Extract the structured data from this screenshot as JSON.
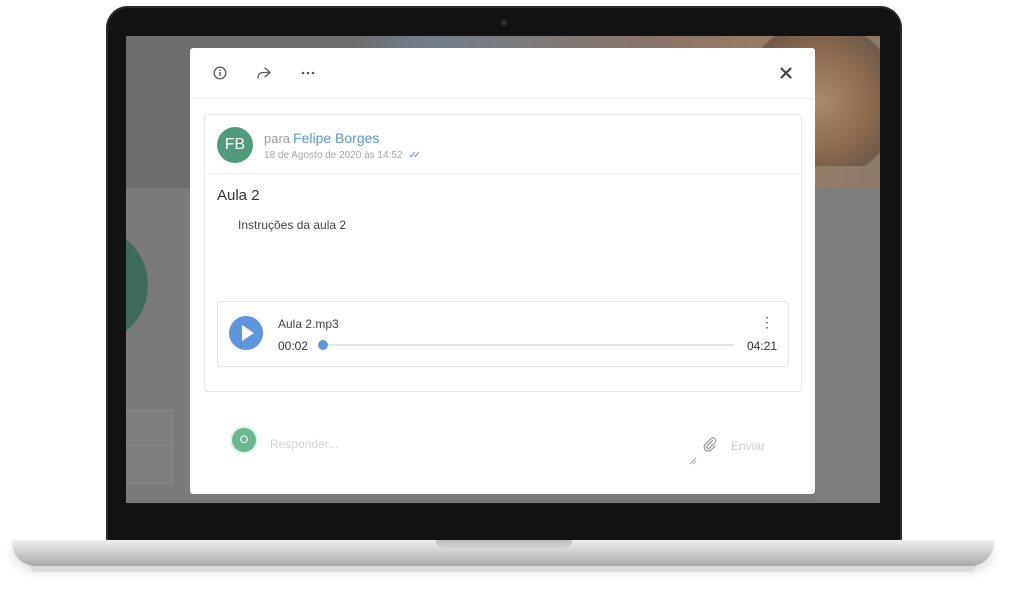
{
  "toolbar": {
    "icons": [
      "info-icon",
      "share-icon",
      "more-icon",
      "close-icon"
    ]
  },
  "message": {
    "avatar_initials": "FB",
    "to_prefix": "para",
    "recipient": "Felipe Borges",
    "date": "18 de Agosto de 2020 às 14:52",
    "title": "Aula 2",
    "description": "Instruções da aula 2"
  },
  "audio": {
    "file_name": "Aula 2.mp3",
    "current_time": "00:02",
    "total_time": "04:21",
    "progress": 0.008,
    "accent": "#5f95dd"
  },
  "reply": {
    "avatar_initial": "O",
    "placeholder": "Responder...",
    "send_label": "Enviar"
  },
  "colors": {
    "avatar": "#4f9b7c",
    "link": "#5e97c9"
  }
}
